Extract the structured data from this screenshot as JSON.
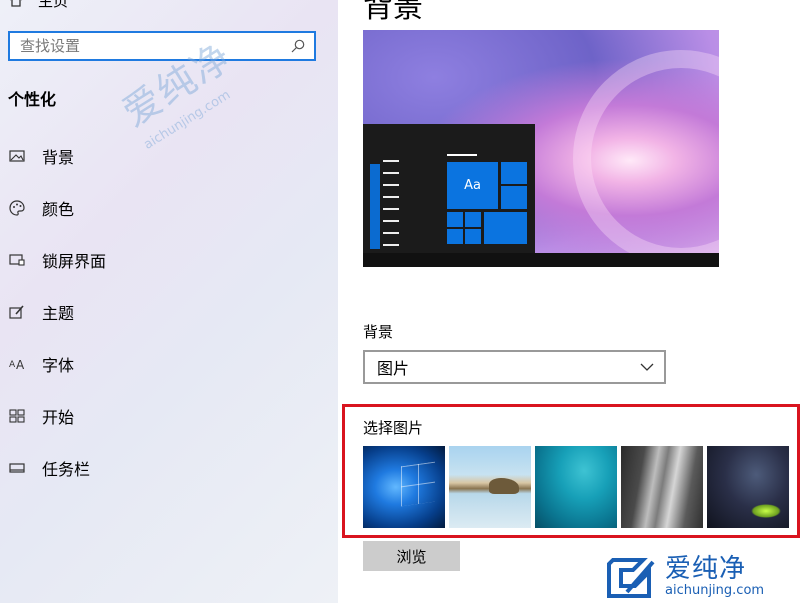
{
  "sidebar": {
    "home_label": "主页",
    "search": {
      "placeholder": "查找设置"
    },
    "section_title": "个性化",
    "items": [
      {
        "label": "背景",
        "icon": "picture-icon"
      },
      {
        "label": "颜色",
        "icon": "palette-icon"
      },
      {
        "label": "锁屏界面",
        "icon": "lock-screen-icon"
      },
      {
        "label": "主题",
        "icon": "theme-brush-icon"
      },
      {
        "label": "字体",
        "icon": "font-icon"
      },
      {
        "label": "开始",
        "icon": "start-tiles-icon"
      },
      {
        "label": "任务栏",
        "icon": "taskbar-icon"
      }
    ]
  },
  "main": {
    "title": "背景",
    "preview": {
      "tile_label": "Aa"
    },
    "background_field": {
      "label": "背景",
      "value": "图片"
    },
    "choose_picture": {
      "label": "选择图片",
      "thumbnails": [
        "windows-10-hero",
        "beach-rocks-reflection",
        "underwater-swimmer",
        "rock-cliff",
        "night-sky-tent"
      ]
    },
    "browse_label": "浏览"
  },
  "watermarks": {
    "center": {
      "cn": "爱纯净",
      "en": "aichunjing.com"
    },
    "bottom_right": {
      "cn": "爱纯净",
      "en": "aichunjing.com"
    }
  },
  "colors": {
    "accent": "#1f7ae0",
    "highlight_border": "#d9141f",
    "tile_blue": "#0b74e0"
  }
}
